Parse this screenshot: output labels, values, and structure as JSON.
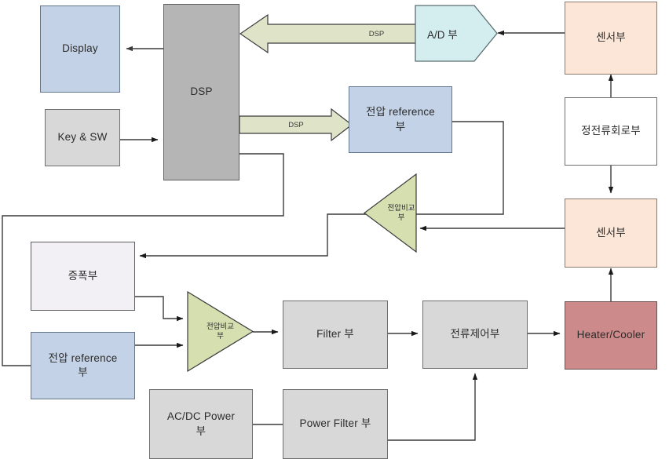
{
  "diagram": {
    "title": "System block diagram",
    "colors": {
      "blue_fill": "#c3d2e6",
      "gray_fill": "#d8d8d8",
      "dsp_fill": "#b5b5b5",
      "peach_fill": "#fbe6d7",
      "green_fill": "#d5dfb0",
      "cyan_fill": "#d4eef0",
      "red_fill": "#cd8a8a",
      "white_fill": "#ffffff",
      "lilac_fill": "#f2f0f5",
      "line": "#404040"
    },
    "nodes": {
      "display": {
        "label": "Display"
      },
      "key_sw": {
        "label": "Key & SW"
      },
      "dsp": {
        "label": "DSP"
      },
      "ad": {
        "label": "A/D 부"
      },
      "sensor_top": {
        "label": "센서부"
      },
      "cc_circuit": {
        "label": "정전류회로부"
      },
      "sensor_mid": {
        "label": "센서부"
      },
      "vref_top": {
        "label": "전압 reference\n부"
      },
      "vcomp_right": {
        "label": "전압비교\n부"
      },
      "amp": {
        "label": "증폭부"
      },
      "vref_bottom": {
        "label": "전압 reference\n부"
      },
      "vcomp_left": {
        "label": "전압비교\n부"
      },
      "filter": {
        "label": "Filter 부"
      },
      "current_ctrl": {
        "label": "전류제어부"
      },
      "heater_cooler": {
        "label": "Heater/Cooler"
      },
      "acdc_power": {
        "label": "AC/DC Power\n부"
      },
      "power_filter": {
        "label": "Power Filter 부"
      }
    },
    "edge_labels": {
      "dsp_bus_in": "DSP",
      "dsp_bus_out": "DSP"
    }
  }
}
